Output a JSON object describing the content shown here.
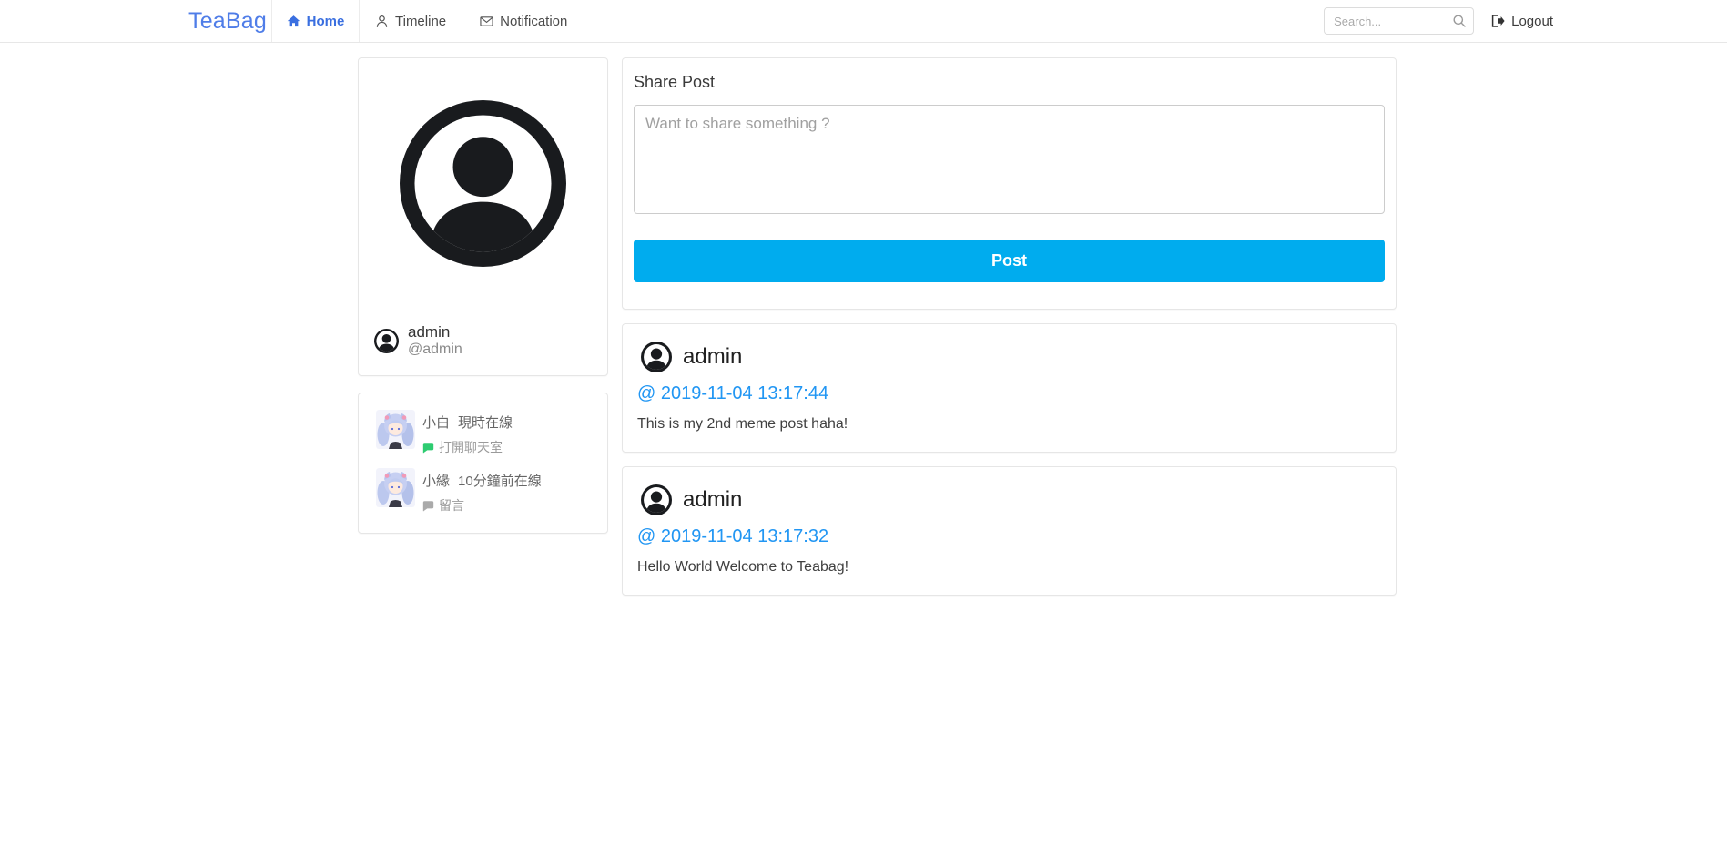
{
  "brand": "TeaBag",
  "nav": {
    "items": [
      {
        "label": "Home",
        "icon": "home-icon",
        "active": true
      },
      {
        "label": "Timeline",
        "icon": "person-icon",
        "active": false
      },
      {
        "label": "Notification",
        "icon": "envelope-icon",
        "active": false
      }
    ]
  },
  "search": {
    "placeholder": "Search...",
    "icon": "search-icon"
  },
  "logout": {
    "label": "Logout",
    "icon": "logout-icon"
  },
  "profile": {
    "avatar_icon": "user-circle-icon",
    "name": "admin",
    "handle": "@admin"
  },
  "friends": [
    {
      "name": "小白",
      "status": "現時在線",
      "action": "打開聊天室",
      "action_icon": "chat-bubble-icon",
      "action_color": "#2ecc71"
    },
    {
      "name": "小緣",
      "status": "10分鐘前在線",
      "action": "留言",
      "action_icon": "chat-bubble-icon",
      "action_color": "#aaaaaa"
    }
  ],
  "share": {
    "title": "Share Post",
    "placeholder": "Want to share something ?",
    "button": "Post"
  },
  "posts": [
    {
      "author": "admin",
      "avatar_icon": "user-circle-icon",
      "timestamp": "@ 2019-11-04 13:17:44",
      "text": "This is my 2nd meme post haha!"
    },
    {
      "author": "admin",
      "avatar_icon": "user-circle-icon",
      "timestamp": "@ 2019-11-04 13:17:32",
      "text": "Hello World Welcome to Teabag!"
    }
  ],
  "colors": {
    "brand_blue": "#4f7de8",
    "active_nav_blue": "#3a6fe0",
    "post_button_blue": "#00acee",
    "timestamp_blue": "#2196f3",
    "online_green": "#2ecc71",
    "muted_gray": "#9a9a9a"
  }
}
